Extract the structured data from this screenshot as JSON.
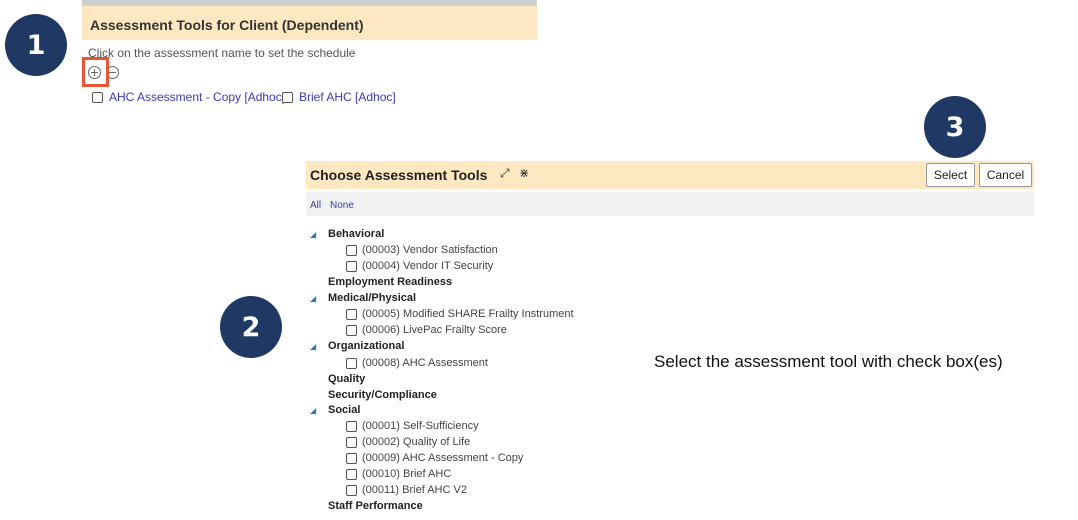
{
  "markers": [
    "1",
    "2",
    "3"
  ],
  "top_panel": {
    "title": "Assessment Tools for Client (Dependent)",
    "hint": "Click on the assessment name to set the schedule",
    "add_glyph": "+",
    "remove_glyph": "−",
    "items": [
      "AHC Assessment - Copy [Adhoc]",
      "Brief AHC [Adhoc]"
    ]
  },
  "choose_panel": {
    "title": "Choose Assessment Tools",
    "select_label": "Select",
    "cancel_label": "Cancel",
    "all_label": "All",
    "none_label": "None",
    "categories": [
      {
        "name": "Behavioral",
        "tools": [
          "(00003) Vendor Satisfaction",
          "(00004) Vendor IT Security"
        ]
      },
      {
        "name": "Employment Readiness",
        "tools": []
      },
      {
        "name": "Medical/Physical",
        "tools": [
          "(00005) Modified SHARE Frailty Instrument",
          "(00006) LivePac Frailty Score"
        ]
      },
      {
        "name": "Organizational",
        "tools": [
          "(00008) AHC Assessment"
        ]
      },
      {
        "name": "Quality",
        "tools": []
      },
      {
        "name": "Security/Compliance",
        "tools": []
      },
      {
        "name": "Social",
        "tools": [
          "(00001) Self-Sufficiency",
          "(00002) Quality of Life",
          "(00009) AHC Assessment - Copy",
          "(00010) Brief AHC",
          "(00011) Brief AHC V2"
        ]
      },
      {
        "name": "Staff Performance",
        "tools": []
      }
    ]
  },
  "note": "Select the assessment tool with check box(es)",
  "colors": {
    "header_bg": "#fde8c2",
    "marker_bg": "#1f3864",
    "link": "#3a3ab8",
    "highlight": "#e8543a",
    "tree_arrow": "#2b7bc0"
  }
}
